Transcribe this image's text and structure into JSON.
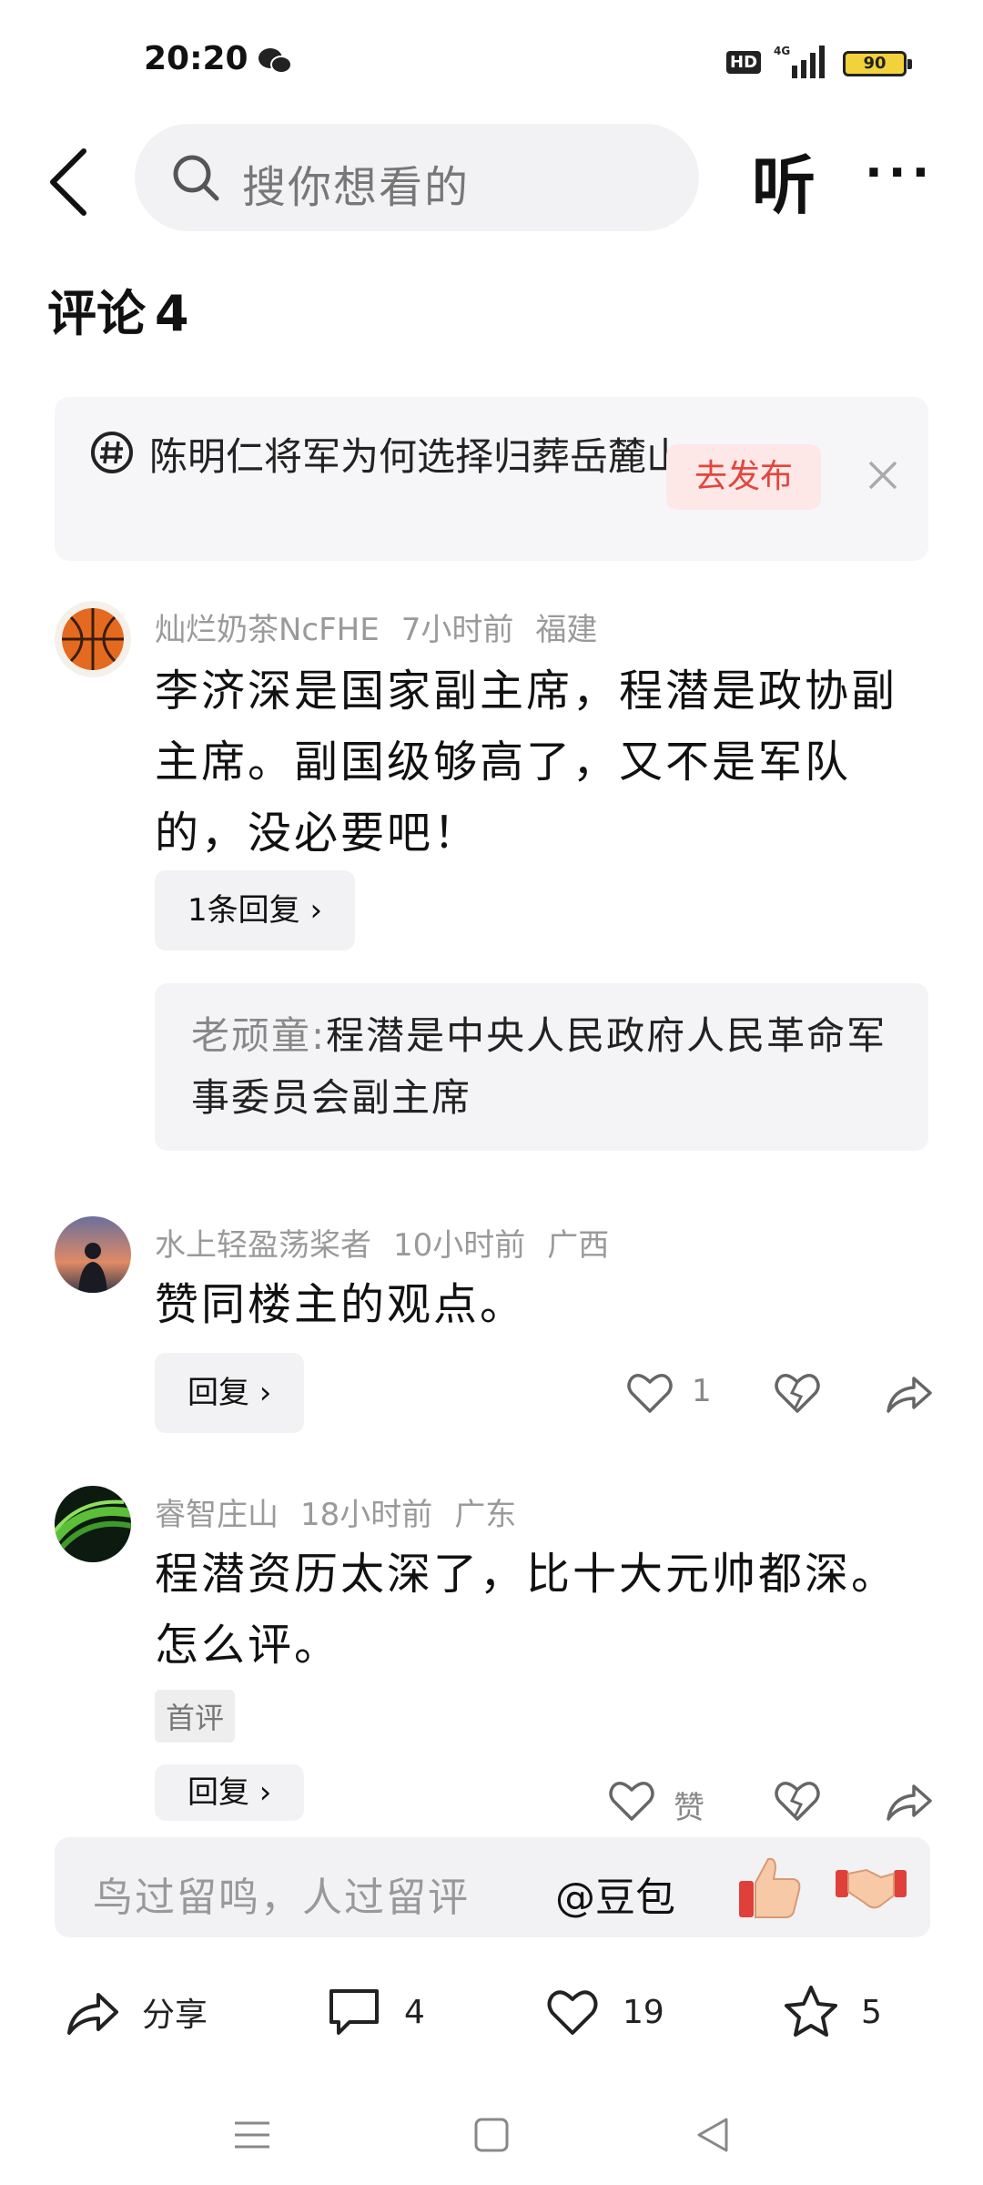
{
  "status_bar": {
    "time": "20:20",
    "network": "4G",
    "hd_label": "HD",
    "battery": "90"
  },
  "header": {
    "search_placeholder": "搜你想看的",
    "listen_label": "听",
    "more_label": "···"
  },
  "comments_section": {
    "title": "评论",
    "count": "4"
  },
  "topic": {
    "text": "陈明仁将军为何选择归葬岳麓山",
    "publish_label": "去发布"
  },
  "comments": [
    {
      "author": "灿烂奶茶NcFHE",
      "time": "7小时前",
      "location": "福建",
      "text": "李济深是国家副主席，程潜是政协副主席。副国级够高了，又不是军队的，没必要吧！",
      "reply_label": "1条回复 ›",
      "sub_reply_author": "老顽童:",
      "sub_reply_text": "程潜是中央人民政府人民革命军事委员会副主席"
    },
    {
      "author": "水上轻盈荡桨者",
      "time": "10小时前",
      "location": "广西",
      "text": "赞同楼主的观点。",
      "reply_label": "回复 ›",
      "likes": "1"
    },
    {
      "author": "睿智庄山",
      "time": "18小时前",
      "location": "广东",
      "text": "程潜资历太深了，比十大元帅都深。怎么评。",
      "badge": "首评",
      "reply_label": "回复 ›",
      "likes": "赞"
    }
  ],
  "input_bar": {
    "placeholder": "鸟过留鸣，人过留评",
    "mention": "@豆包"
  },
  "bottom_actions": {
    "share_label": "分享",
    "comments": "4",
    "likes": "19",
    "favorites": "5"
  },
  "colors": {
    "accent_red": "#e2463c",
    "publish_bg": "#fde7e7",
    "card_bg": "#f4f4f6"
  }
}
